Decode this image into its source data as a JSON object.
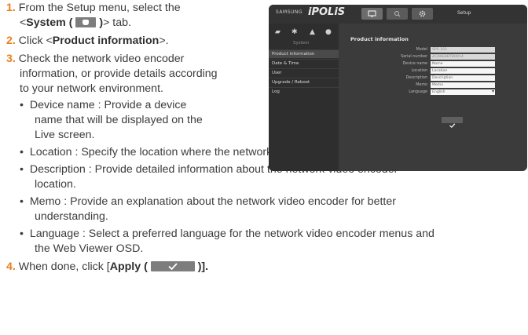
{
  "steps": {
    "s1": {
      "num": "1.",
      "line1": "From the Setup menu, select the",
      "open": "<",
      "bold": "System (",
      "chip_close": ")",
      "tail": "> tab."
    },
    "s2": {
      "num": "2.",
      "pre": "Click <",
      "bold": "Product information",
      "post": ">."
    },
    "s3": {
      "num": "3.",
      "line1": "Check the network video encoder",
      "line2": "information, or provide details according",
      "line3": "to your network environment."
    },
    "s4": {
      "num": "4.",
      "pre": "When done, click [",
      "bold": "Apply (",
      "post": ")]."
    }
  },
  "bullets": {
    "device_name": {
      "line1": "Device name : Provide a device",
      "line2": "name that will be displayed on the",
      "line3": "Live screen."
    },
    "location": {
      "line1": "Location : Specify the location where the network video encoder is installed."
    },
    "description": {
      "line1": "Description : Provide detailed information about the network video encoder",
      "line2": "location."
    },
    "memo": {
      "line1": "Memo : Provide an explanation about the network video encoder for better",
      "line2": "understanding."
    },
    "language": {
      "line1": "Language : Select a preferred language for the network video encoder menus and",
      "line2": "the Web Viewer OSD."
    }
  },
  "inline_icons": {
    "system_tab": "system-tab-icon",
    "apply": "checkmark-icon"
  },
  "screenshot": {
    "brand": "SAMSUNG",
    "product": "iPOLiS",
    "setup_label": "Setup",
    "top_icons": [
      "monitor-icon",
      "search-icon",
      "gear-icon"
    ],
    "side_icons": [
      "video-icon",
      "network-icon",
      "event-icon",
      "system-icon"
    ],
    "side_caption": "System",
    "side_items": [
      "Product information",
      "Date & Time",
      "User",
      "Upgrade / Reboot",
      "Log"
    ],
    "panel_title": "Product information",
    "fields": [
      {
        "label": "Model",
        "value": "SPE-101"
      },
      {
        "label": "Serial number",
        "value": "ZCD6E8DTB0014"
      },
      {
        "label": "Device name",
        "value": "Name"
      },
      {
        "label": "Location",
        "value": "Location"
      },
      {
        "label": "Description",
        "value": "Description"
      },
      {
        "label": "Memo",
        "value": "Memo"
      },
      {
        "label": "Language",
        "value": "English"
      }
    ],
    "colors": {
      "panel_bg": "#3b3b3b",
      "sidebar_bg": "#2e2e2e",
      "accent_number": "#e8801c"
    }
  }
}
